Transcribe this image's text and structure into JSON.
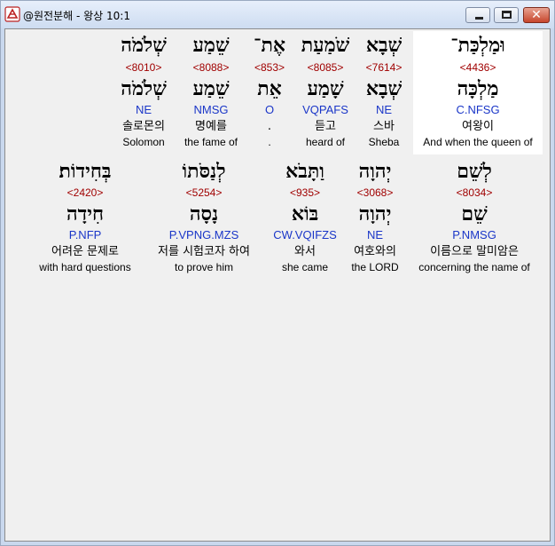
{
  "window": {
    "title": "@원전분해 - 왕상 10:1"
  },
  "rows": [
    {
      "words": [
        {
          "surface": "וּמַלְכַּת־",
          "strong": "<4436>",
          "lemma": "מַלְכָּה",
          "morph": "C.NFSG",
          "korean": "여왕이",
          "english": "And when the queen of"
        },
        {
          "surface": "שְׁבָא",
          "strong": "<7614>",
          "lemma": "שְׁבָא",
          "morph": "NE",
          "korean": "스바",
          "english": "Sheba"
        },
        {
          "surface": "שֹׁמַעַת",
          "strong": "<8085>",
          "lemma": "שָׁמַע",
          "morph": "VQPAFS",
          "korean": "듣고",
          "english": "heard of"
        },
        {
          "surface": "אֶת־",
          "strong": "<853>",
          "lemma": "אֵת",
          "morph": "O",
          "korean": ".",
          "english": "."
        },
        {
          "surface": "שֵׁמַע",
          "strong": "<8088>",
          "lemma": "שֵׁמַע",
          "morph": "NMSG",
          "korean": "명예를",
          "english": "the fame of"
        },
        {
          "surface": "שְׁלֹמֹה",
          "strong": "<8010>",
          "lemma": "שְׁלֹמֹה",
          "morph": "NE",
          "korean": "솔로몬의",
          "english": "Solomon"
        }
      ]
    },
    {
      "words": [
        {
          "surface": "לְשֵׁם",
          "strong": "<8034>",
          "lemma": "שֵׁם",
          "morph": "P.NMSG",
          "korean": "이름으로 말미암은",
          "english": "concerning the name of"
        },
        {
          "surface": "יְהוָה",
          "strong": "<3068>",
          "lemma": "יְהוָה",
          "morph": "NE",
          "korean": "여호와의",
          "english": "the LORD"
        },
        {
          "surface": "וַתָּבֹא",
          "strong": "<935>",
          "lemma": "בּוֹא",
          "morph": "CW.VQIFZS",
          "korean": "와서",
          "english": "she came"
        },
        {
          "surface": "לְנַסֹּתוֹ",
          "strong": "<5254>",
          "lemma": "נָסָה",
          "morph": "P.VPNG.MZS",
          "korean": "저를 시험코자 하여",
          "english": "to prove him"
        },
        {
          "surface": "בְּחִידוֹת׃",
          "strong": "<2420>",
          "lemma": "חִידָה",
          "morph": "P.NFP",
          "korean": "어려운 문제로",
          "english": "with hard questions"
        }
      ]
    }
  ]
}
